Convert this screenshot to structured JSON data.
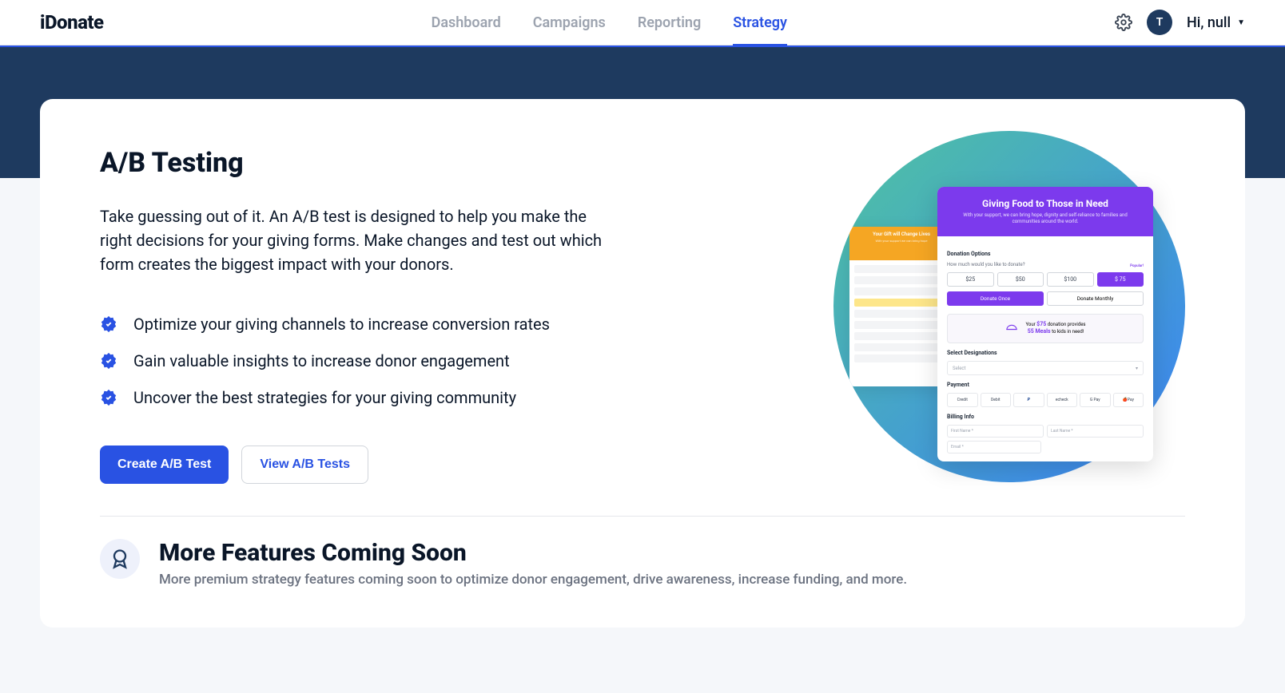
{
  "logo": "iDonate",
  "nav": {
    "items": [
      {
        "label": "Dashboard",
        "active": false
      },
      {
        "label": "Campaigns",
        "active": false
      },
      {
        "label": "Reporting",
        "active": false
      },
      {
        "label": "Strategy",
        "active": true
      }
    ]
  },
  "user": {
    "avatar_initial": "T",
    "greeting": "Hi, null"
  },
  "page": {
    "title": "A/B Testing",
    "description": "Take guessing out of it. An A/B test is designed to help you make the right decisions for your giving forms. Make changes and test out which form creates the biggest impact with your donors.",
    "benefits": [
      "Optimize your giving channels to increase conversion rates",
      "Gain valuable insights to increase donor engagement",
      "Uncover the best strategies for your giving community"
    ],
    "create_btn": "Create A/B Test",
    "view_btn": "View A/B Tests"
  },
  "illustration": {
    "form_back": {
      "title": "Your Gift will Change Lives",
      "subtitle": "With your support we can bring hope"
    },
    "form_front": {
      "title": "Giving Food to Those in Need",
      "subtitle": "With your support, we can bring hope, dignity and self-reliance to families and communities around the world.",
      "donation_options_label": "Donation Options",
      "amount_question": "How much would you like to donate?",
      "popular_label": "Popular!",
      "amounts": [
        "$25",
        "$50",
        "$100",
        "$ 75"
      ],
      "selected_amount_index": 3,
      "freq": {
        "once": "Donate Once",
        "monthly": "Donate Monthly"
      },
      "impact": {
        "prefix": "Your",
        "amount": "$75",
        "provides": "donation provides",
        "meals": "55 Meals",
        "suffix": "to kids in need!"
      },
      "designations_label": "Select Designations",
      "select_placeholder": "Select",
      "payment_label": "Payment",
      "pay_methods": [
        "Credit",
        "Debit",
        "PayPal",
        "echeck",
        "G Pay",
        "🍎Pay"
      ],
      "billing_label": "Billing Info",
      "first_name": "First Name *",
      "last_name": "Last Name *",
      "email": "Email *"
    }
  },
  "coming_soon": {
    "title": "More Features Coming Soon",
    "description": "More premium strategy features coming soon to optimize donor engagement, drive awareness, increase funding, and more."
  }
}
